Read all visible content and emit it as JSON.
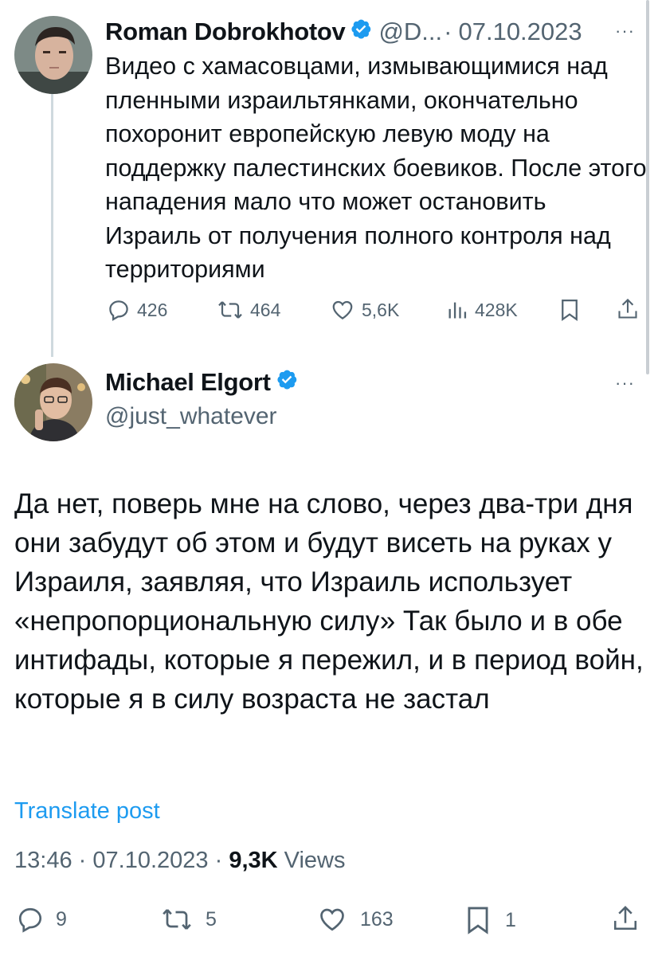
{
  "parent_tweet": {
    "author_name": "Roman Dobrokhotov",
    "handle": "@D...",
    "separator": "·",
    "date": "07.10.2023",
    "more_label": "···",
    "text": "Видео с хамасовцами, измывающимися над пленными израильтянками, окончательно похоронит европейскую левую моду на поддержку палестинских боевиков. После этого нападения мало что может остановить Израиль от получения полного контроля над территориями",
    "stats": {
      "replies": "426",
      "reposts": "464",
      "likes": "5,6K",
      "views": "428K"
    }
  },
  "reply_tweet": {
    "author_name": "Michael Elgort",
    "handle": "@just_whatever",
    "more_label": "···",
    "text": "Да нет, поверь мне на слово, через два-три дня они забудут об этом и будут висеть на руках у Израиля, заявляя, что Израиль использует «непропорциональную силу» Так было и в обе интифады, которые я пережил, и в период войн, которые я в силу возраста не застал",
    "translate_label": "Translate post",
    "time": "13:46",
    "separator": "·",
    "date": "07.10.2023",
    "views_count": "9,3K",
    "views_label": "Views",
    "stats": {
      "replies": "9",
      "reposts": "5",
      "likes": "163",
      "bookmarks": "1"
    }
  },
  "colors": {
    "text": "#0f1419",
    "secondary": "#536471",
    "accent": "#1d9bf0",
    "thread_line": "#cfd9de"
  },
  "icons": [
    "reply-icon",
    "repost-icon",
    "like-icon",
    "views-icon",
    "bookmark-icon",
    "share-icon",
    "verified-badge-icon"
  ]
}
